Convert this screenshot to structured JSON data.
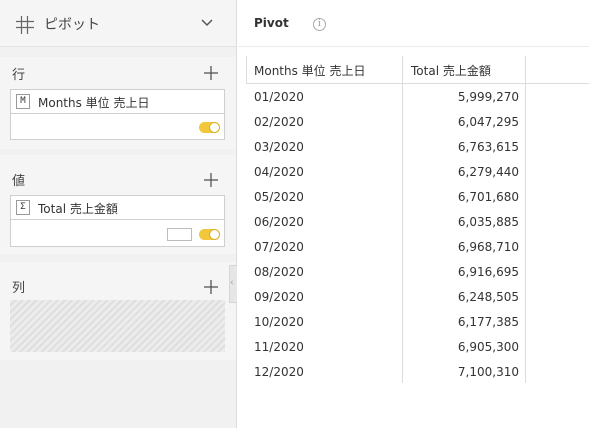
{
  "panel": {
    "title": "ピボット",
    "rows_label": "行",
    "values_label": "値",
    "columns_label": "列",
    "row_field": {
      "badge": "M",
      "label": "Months 単位 売上日"
    },
    "value_field": {
      "badge": "Σ",
      "label": "Total 売上金額"
    }
  },
  "pivot": {
    "title": "Pivot",
    "info": "i",
    "columns": [
      "Months 単位 売上日",
      "Total 売上金額"
    ],
    "rows": [
      {
        "month": "01/2020",
        "total": "5,999,270"
      },
      {
        "month": "02/2020",
        "total": "6,047,295"
      },
      {
        "month": "03/2020",
        "total": "6,763,615"
      },
      {
        "month": "04/2020",
        "total": "6,279,440"
      },
      {
        "month": "05/2020",
        "total": "6,701,680"
      },
      {
        "month": "06/2020",
        "total": "6,035,885"
      },
      {
        "month": "07/2020",
        "total": "6,968,710"
      },
      {
        "month": "08/2020",
        "total": "6,916,695"
      },
      {
        "month": "09/2020",
        "total": "6,248,505"
      },
      {
        "month": "10/2020",
        "total": "6,177,385"
      },
      {
        "month": "11/2020",
        "total": "6,905,300"
      },
      {
        "month": "12/2020",
        "total": "7,100,310"
      }
    ]
  },
  "colors": {
    "toggle": "#f2c73a",
    "panel_bg": "#f1f1f1"
  }
}
